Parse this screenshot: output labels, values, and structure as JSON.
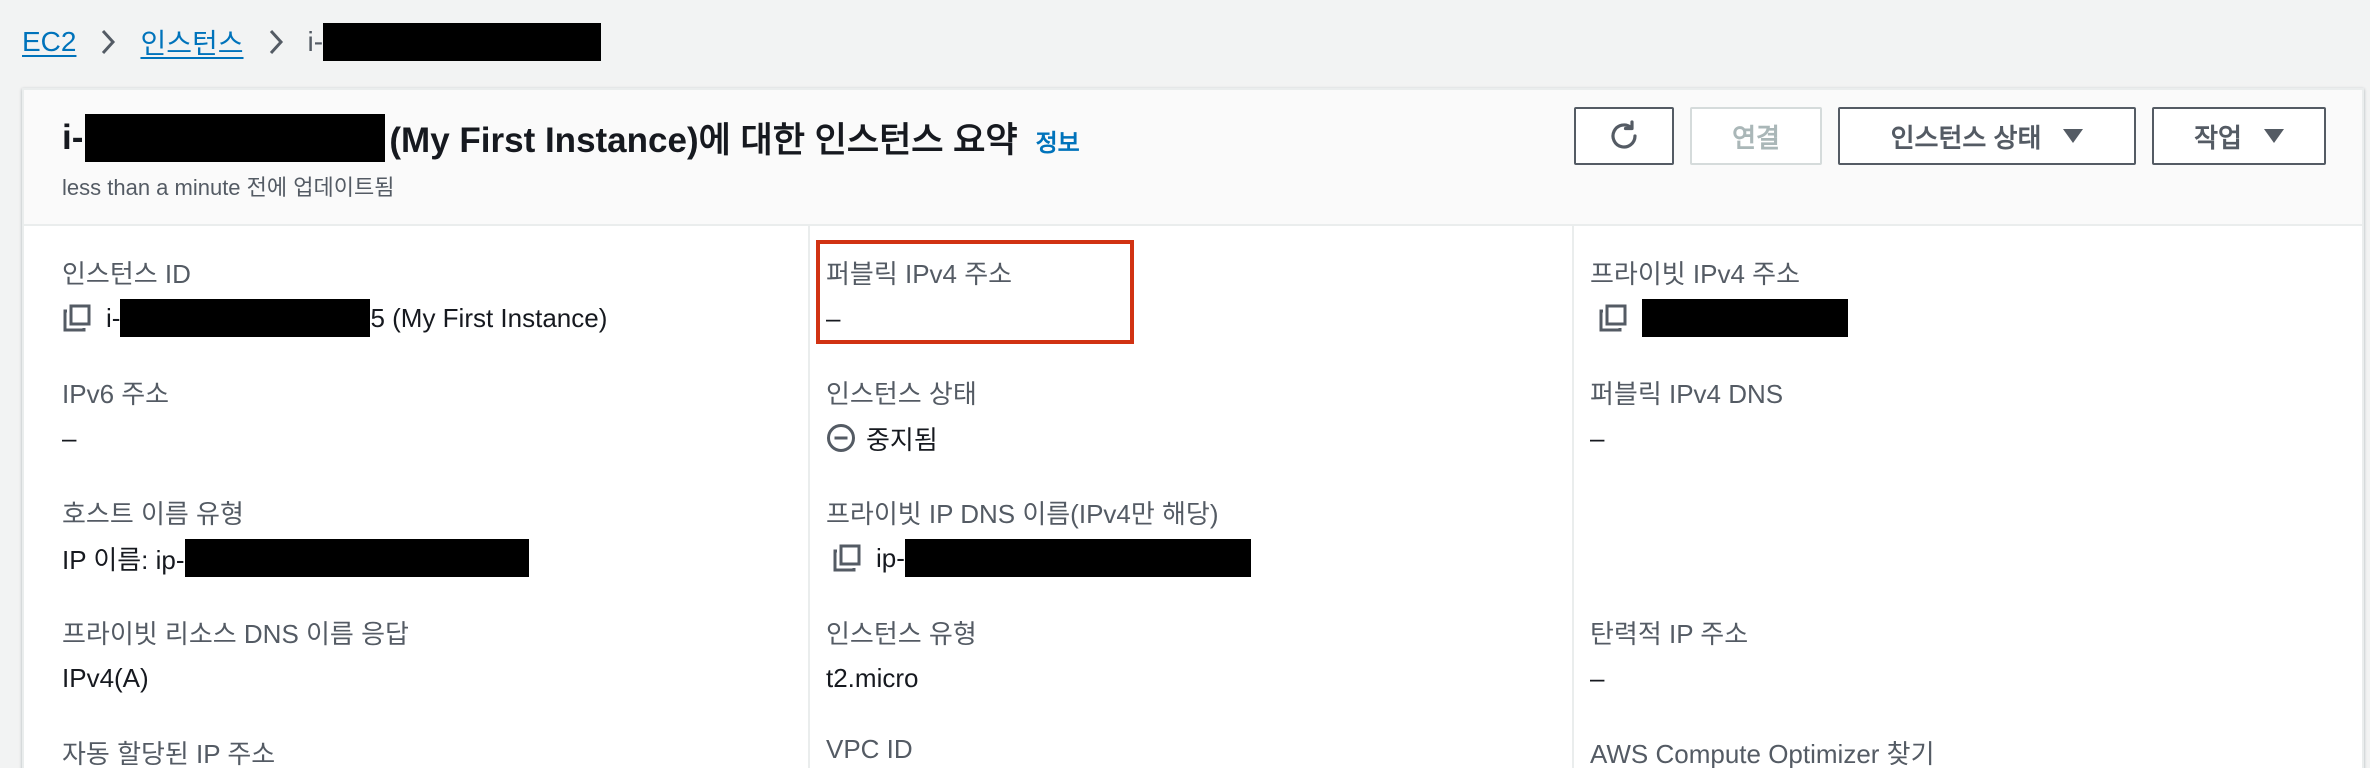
{
  "breadcrumb": {
    "root": "EC2",
    "section": "인스턴스",
    "current_prefix": "i-"
  },
  "header": {
    "title_prefix": "i-",
    "title_suffix": "(My First Instance)에 대한 인스턴스 요약",
    "info_link": "정보",
    "updated": "less than a minute 전에 업데이트됨"
  },
  "actions": {
    "refresh_icon": "refresh-icon",
    "connect": "연결",
    "instance_state": "인스턴스 상태",
    "action": "작업"
  },
  "fields": {
    "instance_id": {
      "label": "인스턴스 ID",
      "value_prefix": "i-",
      "value_suffix": "5 (My First Instance)"
    },
    "public_ipv4": {
      "label": "퍼블릭 IPv4 주소",
      "value": "–"
    },
    "private_ipv4": {
      "label": "프라이빗 IPv4 주소"
    },
    "ipv6": {
      "label": "IPv6 주소",
      "value": "–"
    },
    "instance_state": {
      "label": "인스턴스 상태",
      "value": "중지됨"
    },
    "public_ipv4_dns": {
      "label": "퍼블릭 IPv4 DNS",
      "value": "–"
    },
    "hostname_type": {
      "label": "호스트 이름 유형",
      "value_prefix": "IP 이름: ip-"
    },
    "private_ip_dns": {
      "label": "프라이빗 IP DNS 이름(IPv4만 해당)",
      "value_prefix": "ip-"
    },
    "private_resource_dns": {
      "label": "프라이빗 리소스 DNS 이름 응답",
      "value": "IPv4(A)"
    },
    "instance_type": {
      "label": "인스턴스 유형",
      "value": "t2.micro"
    },
    "elastic_ip": {
      "label": "탄력적 IP 주소",
      "value": "–"
    },
    "auto_ip": {
      "label": "자동 할당된 IP 주소"
    },
    "vpc_id": {
      "label": "VPC ID"
    },
    "optimizer": {
      "label": "AWS Compute Optimizer 찾기"
    }
  },
  "colors": {
    "link": "#0073bb",
    "highlight": "#d13212",
    "text": "#16191f",
    "muted": "#545b64"
  }
}
